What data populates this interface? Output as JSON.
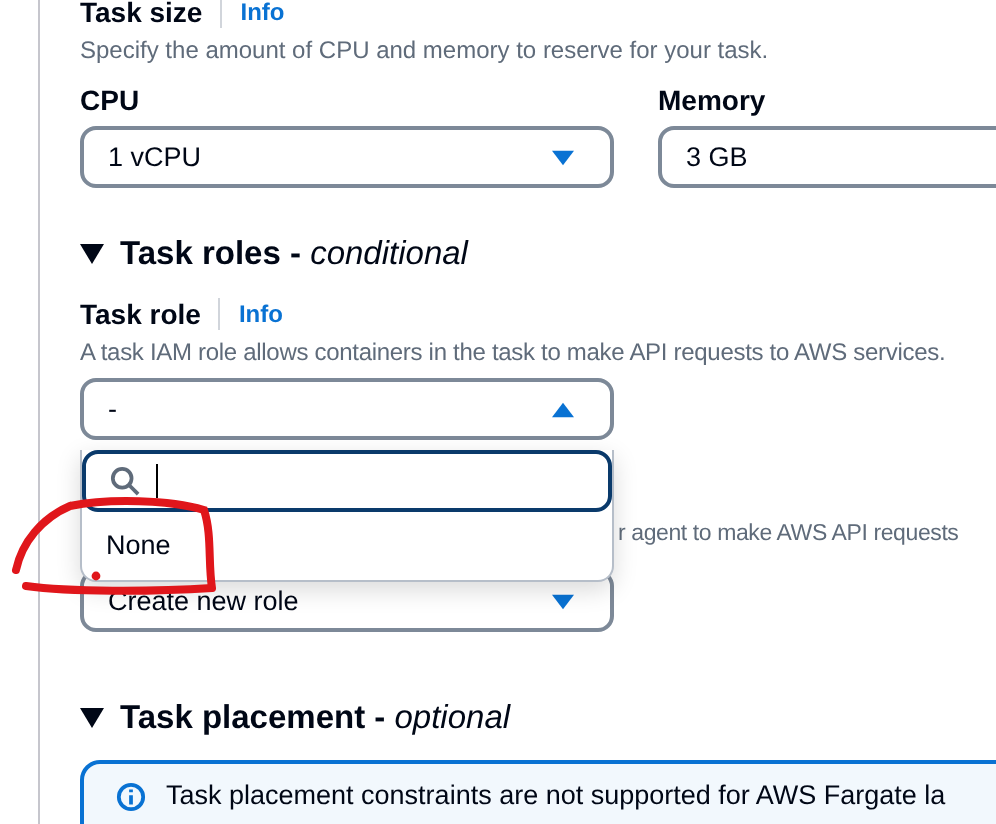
{
  "task_size": {
    "label": "Task size",
    "info_link": "Info",
    "description": "Specify the amount of CPU and memory to reserve for your task.",
    "cpu": {
      "label": "CPU",
      "value": "1 vCPU"
    },
    "memory": {
      "label": "Memory",
      "value": "3 GB"
    }
  },
  "task_roles": {
    "heading": "Task roles - *conditional*",
    "expanded": true,
    "task_role": {
      "label": "Task role",
      "info_link": "Info",
      "description": "A task IAM role allows containers in the task to make API requests to AWS services.",
      "value": "-",
      "expanded": true,
      "options": [
        {
          "label": "None",
          "selected": false
        }
      ]
    },
    "execution_role": {
      "description": "r agent to make AWS API requests",
      "value": "Create new role",
      "expanded": false
    }
  },
  "task_placement": {
    "heading": "Task placement - *optional*",
    "expanded": true,
    "alert": "Task placement constraints are not supported for AWS Fargate la"
  },
  "annotation": {
    "kind": "circle",
    "color": "#e0161b"
  }
}
